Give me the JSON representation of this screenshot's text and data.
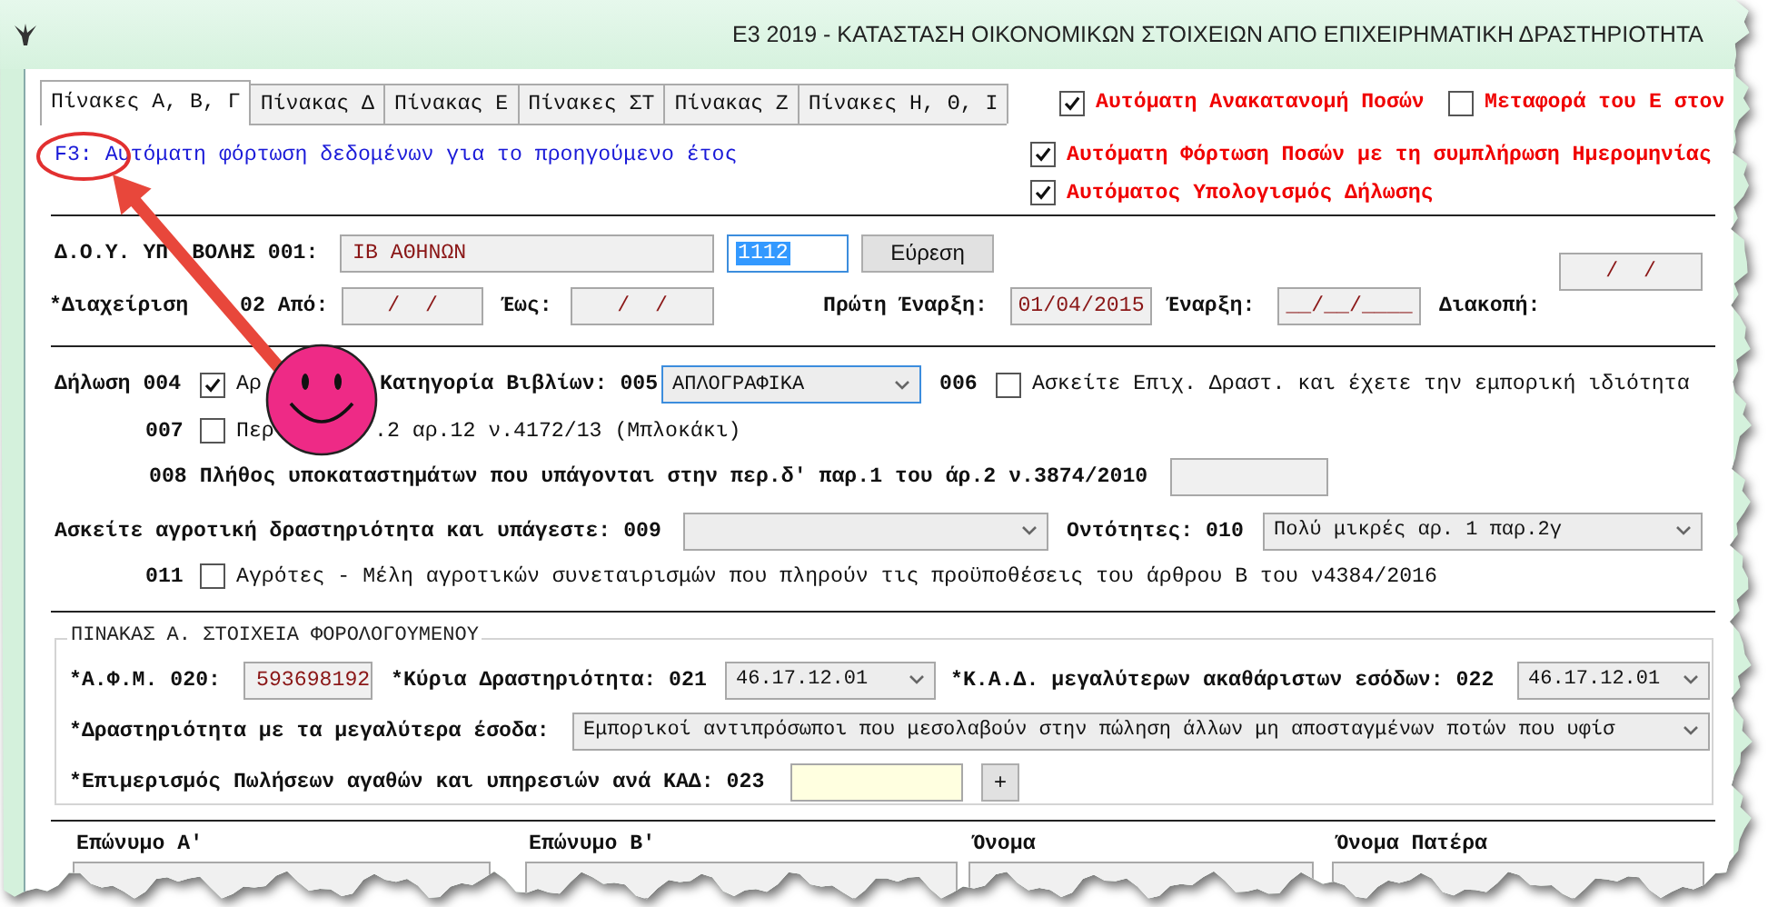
{
  "window": {
    "title": "Ε3 2019 - ΚΑΤΑΣΤΑΣΗ ΟΙΚΟΝΟΜΙΚΩΝ ΣΤΟΙΧΕΙΩΝ ΑΠΟ ΕΠΙΧΕΙΡΗΜΑΤΙΚΗ ΔΡΑΣΤΗΡΙΟΤΗΤΑ"
  },
  "tabs": [
    {
      "label": "Πίνακες Α, Β, Γ",
      "selected": true
    },
    {
      "label": "Πίνακας Δ",
      "selected": false
    },
    {
      "label": "Πίνακας Ε",
      "selected": false
    },
    {
      "label": "Πίνακες ΣΤ",
      "selected": false
    },
    {
      "label": "Πίνακας Ζ",
      "selected": false
    },
    {
      "label": "Πίνακες Η, Θ, Ι",
      "selected": false
    }
  ],
  "top_options": [
    {
      "label": "Αυτόματη Ανακατανομή Ποσών",
      "checked": true
    },
    {
      "label": "Μεταφορά του Ε στον",
      "checked": false
    }
  ],
  "hint": "F3: Αυτόματη φόρτωση δεδομένων για το προηγούμενο έτος",
  "auto_options": [
    {
      "label": "Αυτόματη Φόρτωση Ποσών με τη συμπλήρωση Ημερομηνίας",
      "checked": true
    },
    {
      "label": "Αυτόματος Υπολογισμός Δήλωσης",
      "checked": true
    }
  ],
  "tax_office": {
    "label_parts": [
      "Δ.Ο.Υ. ΥΠ",
      "ΒΟΛΗΣ 001:"
    ],
    "name": "ΙΒ ΑΘΗΝΩΝ",
    "code": "1112",
    "search_button": "Εύρεση",
    "side_date": "/  /"
  },
  "period": {
    "label_parts": [
      "*Διαχείριση",
      "02 Από:"
    ],
    "from": "/  /",
    "to_label": "Έως:",
    "to": "/  /",
    "first_start_label": "Πρώτη Έναρξη:",
    "first_start": "01/04/2015",
    "start_label": "Έναρξη:",
    "start": "__/__/____",
    "stop_label": "Διακοπή:"
  },
  "declaration": {
    "label": "Δήλωση 004",
    "checked": true,
    "text_parts": [
      "Αρ",
      "Κατηγορία Βιβλίων: 005"
    ],
    "books": "ΑΠΛΟΓΡΑΦΙΚΑ",
    "code_006": "006",
    "checked_006": false,
    "text_006": "Ασκείτε Επιχ. Δραστ. και έχετε την εμπορική ιδιότητα"
  },
  "item_007": {
    "code": "007",
    "checked": false,
    "text_parts": [
      "Περ",
      ".2 αρ.12 ν.4172/13 (Μπλοκάκι)"
    ]
  },
  "item_008": {
    "label": "008 Πλήθος υποκαταστημάτων που υπάγονται στην περ.δ' παρ.1 του άρ.2 ν.3874/2010"
  },
  "farming": {
    "label": "Ασκείτε αγροτική δραστηριότητα και υπάγεστε: 009",
    "entities_label": "Οντότητες: 010",
    "entities": "Πολύ μικρές αρ. 1 παρ.2γ"
  },
  "item_011": {
    "code": "011",
    "checked": false,
    "text": "Αγρότες - Μέλη αγροτικών συνεταιρισμών που πληρούν τις προϋποθέσεις του άρθρου Β του ν4384/2016"
  },
  "table_a": {
    "title": "ΠΙΝΑΚΑΣ Α. ΣΤΟΙΧΕΙΑ ΦΟΡΟΛΟΓΟΥΜΕΝΟΥ",
    "afm_label": "*Α.Φ.Μ. 020:",
    "afm": "593698192",
    "main_label": "*Κύρια Δραστηριότητα: 021",
    "main": "46.17.12.01",
    "kad_label": "*Κ.Α.Δ. μεγαλύτερων ακαθάριστων εσόδων: 022",
    "kad": "46.17.12.01",
    "top_label": "*Δραστηριότητα με τα μεγαλύτερα έσοδα:",
    "top": "Εμπορικοί αντιπρόσωποι που μεσολαβούν στην πώληση άλλων μη αποσταγμένων ποτών που υφίσ",
    "split_label": "*Επιμερισμός Πωλήσεων αγαθών και υπηρεσιών ανά ΚΑΔ: 023",
    "add_button": "+"
  },
  "names": {
    "columns": [
      "Επώνυμο Α'",
      "Επώνυμο Β'",
      "Όνομα",
      "Όνομα Πατέρα"
    ]
  }
}
